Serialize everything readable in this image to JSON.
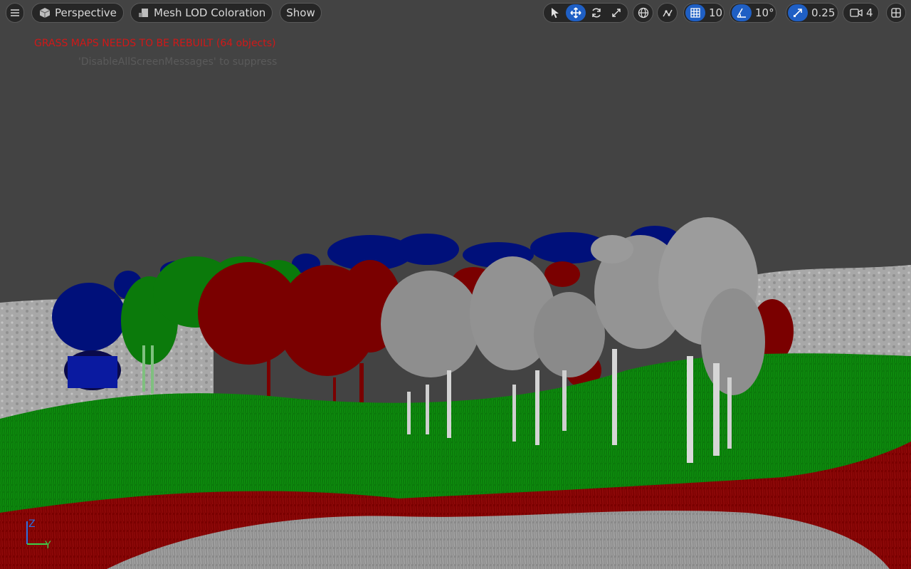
{
  "toolbar": {
    "menu_icon": "hamburger-icon",
    "view_mode": {
      "label": "Perspective",
      "icon": "cube-icon"
    },
    "view_rendering": {
      "label": "Mesh LOD Coloration",
      "icon": "mesh-icon"
    },
    "show": {
      "label": "Show"
    },
    "transform_tools": [
      {
        "name": "select",
        "icon": "cursor-icon",
        "active": false
      },
      {
        "name": "translate",
        "icon": "move-icon",
        "active": true
      },
      {
        "name": "rotate",
        "icon": "rotate-icon",
        "active": false
      },
      {
        "name": "scale",
        "icon": "scale-icon",
        "active": false
      }
    ],
    "coordinate_space_icon": "globe-icon",
    "surface_snapping_icon": "surface-snap-icon",
    "grid_snap": {
      "value": "10",
      "active": true,
      "icon": "grid-icon"
    },
    "rotation_snap": {
      "value": "10°",
      "active": true,
      "icon": "angle-icon"
    },
    "scale_snap": {
      "value": "0.25",
      "active": true,
      "icon": "scale-snap-icon"
    },
    "camera_speed": {
      "value": "4",
      "icon": "camera-icon"
    },
    "layout_icon": "layout-icon"
  },
  "screen_message": {
    "title": "GRASS MAPS NEEDS TO BE REBUILT (64 objects)",
    "subtitle": "'DisableAllScreenMessages' to suppress"
  },
  "axis_gizmo": {
    "z_label": "Z",
    "y_label": "Y"
  },
  "colors": {
    "background": "#434343",
    "lod0_white": "#9a9a9a",
    "lod1_red": "#7a0000",
    "lod2_green": "#0a7a0a",
    "lod3_blue": "#00107a",
    "accent_active": "#1f5fc4",
    "warning_text": "#d01818"
  }
}
